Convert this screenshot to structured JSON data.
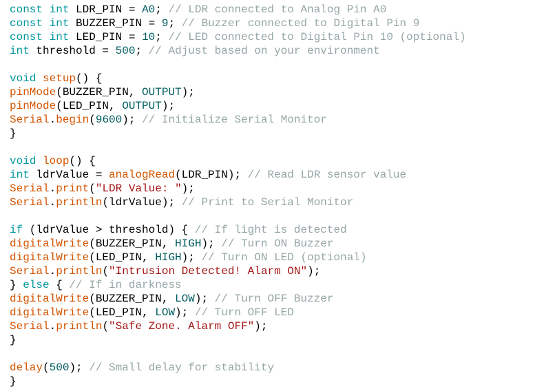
{
  "code": {
    "lines": [
      [
        {
          "t": "const",
          "k": "kw"
        },
        {
          "t": " ",
          "k": "id"
        },
        {
          "t": "int",
          "k": "kw"
        },
        {
          "t": " LDR_PIN = ",
          "k": "id"
        },
        {
          "t": "A0",
          "k": "num"
        },
        {
          "t": "; ",
          "k": "id"
        },
        {
          "t": "// LDR connected to Analog Pin A0",
          "k": "cm"
        }
      ],
      [
        {
          "t": "const",
          "k": "kw"
        },
        {
          "t": " ",
          "k": "id"
        },
        {
          "t": "int",
          "k": "kw"
        },
        {
          "t": " BUZZER_PIN = ",
          "k": "id"
        },
        {
          "t": "9",
          "k": "num"
        },
        {
          "t": "; ",
          "k": "id"
        },
        {
          "t": "// Buzzer connected to Digital Pin 9",
          "k": "cm"
        }
      ],
      [
        {
          "t": "const",
          "k": "kw"
        },
        {
          "t": " ",
          "k": "id"
        },
        {
          "t": "int",
          "k": "kw"
        },
        {
          "t": " LED_PIN = ",
          "k": "id"
        },
        {
          "t": "10",
          "k": "num"
        },
        {
          "t": "; ",
          "k": "id"
        },
        {
          "t": "// LED connected to Digital Pin 10 (optional)",
          "k": "cm"
        }
      ],
      [
        {
          "t": "int",
          "k": "kw"
        },
        {
          "t": " threshold = ",
          "k": "id"
        },
        {
          "t": "500",
          "k": "num"
        },
        {
          "t": "; ",
          "k": "id"
        },
        {
          "t": "// Adjust based on your environment",
          "k": "cm"
        }
      ],
      [],
      [
        {
          "t": "void",
          "k": "kw"
        },
        {
          "t": " ",
          "k": "id"
        },
        {
          "t": "setup",
          "k": "fn"
        },
        {
          "t": "() {",
          "k": "id"
        }
      ],
      [
        {
          "t": "pinMode",
          "k": "fn"
        },
        {
          "t": "(BUZZER_PIN, ",
          "k": "id"
        },
        {
          "t": "OUTPUT",
          "k": "num"
        },
        {
          "t": ");",
          "k": "id"
        }
      ],
      [
        {
          "t": "pinMode",
          "k": "fn"
        },
        {
          "t": "(LED_PIN, ",
          "k": "id"
        },
        {
          "t": "OUTPUT",
          "k": "num"
        },
        {
          "t": ");",
          "k": "id"
        }
      ],
      [
        {
          "t": "Serial",
          "k": "fn"
        },
        {
          "t": ".",
          "k": "id"
        },
        {
          "t": "begin",
          "k": "fn"
        },
        {
          "t": "(",
          "k": "id"
        },
        {
          "t": "9600",
          "k": "num"
        },
        {
          "t": "); ",
          "k": "id"
        },
        {
          "t": "// Initialize Serial Monitor",
          "k": "cm"
        }
      ],
      [
        {
          "t": "}",
          "k": "id"
        }
      ],
      [],
      [
        {
          "t": "void",
          "k": "kw"
        },
        {
          "t": " ",
          "k": "id"
        },
        {
          "t": "loop",
          "k": "fn"
        },
        {
          "t": "() {",
          "k": "id"
        }
      ],
      [
        {
          "t": "int",
          "k": "kw"
        },
        {
          "t": " ldrValue = ",
          "k": "id"
        },
        {
          "t": "analogRead",
          "k": "fn"
        },
        {
          "t": "(LDR_PIN); ",
          "k": "id"
        },
        {
          "t": "// Read LDR sensor value",
          "k": "cm"
        }
      ],
      [
        {
          "t": "Serial",
          "k": "fn"
        },
        {
          "t": ".",
          "k": "id"
        },
        {
          "t": "print",
          "k": "fn"
        },
        {
          "t": "(",
          "k": "id"
        },
        {
          "t": "\"LDR Value: \"",
          "k": "str"
        },
        {
          "t": ");",
          "k": "id"
        }
      ],
      [
        {
          "t": "Serial",
          "k": "fn"
        },
        {
          "t": ".",
          "k": "id"
        },
        {
          "t": "println",
          "k": "fn"
        },
        {
          "t": "(ldrValue); ",
          "k": "id"
        },
        {
          "t": "// Print to Serial Monitor",
          "k": "cm"
        }
      ],
      [],
      [
        {
          "t": "if",
          "k": "kw"
        },
        {
          "t": " (ldrValue > threshold) { ",
          "k": "id"
        },
        {
          "t": "// If light is detected",
          "k": "cm"
        }
      ],
      [
        {
          "t": "digitalWrite",
          "k": "fn"
        },
        {
          "t": "(BUZZER_PIN, ",
          "k": "id"
        },
        {
          "t": "HIGH",
          "k": "num"
        },
        {
          "t": "); ",
          "k": "id"
        },
        {
          "t": "// Turn ON Buzzer",
          "k": "cm"
        }
      ],
      [
        {
          "t": "digitalWrite",
          "k": "fn"
        },
        {
          "t": "(LED_PIN, ",
          "k": "id"
        },
        {
          "t": "HIGH",
          "k": "num"
        },
        {
          "t": "); ",
          "k": "id"
        },
        {
          "t": "// Turn ON LED (optional)",
          "k": "cm"
        }
      ],
      [
        {
          "t": "Serial",
          "k": "fn"
        },
        {
          "t": ".",
          "k": "id"
        },
        {
          "t": "println",
          "k": "fn"
        },
        {
          "t": "(",
          "k": "id"
        },
        {
          "t": "\"Intrusion Detected! Alarm ON\"",
          "k": "str"
        },
        {
          "t": ");",
          "k": "id"
        }
      ],
      [
        {
          "t": "} ",
          "k": "id"
        },
        {
          "t": "else",
          "k": "kw"
        },
        {
          "t": " { ",
          "k": "id"
        },
        {
          "t": "// If in darkness",
          "k": "cm"
        }
      ],
      [
        {
          "t": "digitalWrite",
          "k": "fn"
        },
        {
          "t": "(BUZZER_PIN, ",
          "k": "id"
        },
        {
          "t": "LOW",
          "k": "num"
        },
        {
          "t": "); ",
          "k": "id"
        },
        {
          "t": "// Turn OFF Buzzer",
          "k": "cm"
        }
      ],
      [
        {
          "t": "digitalWrite",
          "k": "fn"
        },
        {
          "t": "(LED_PIN, ",
          "k": "id"
        },
        {
          "t": "LOW",
          "k": "num"
        },
        {
          "t": "); ",
          "k": "id"
        },
        {
          "t": "// Turn OFF LED",
          "k": "cm"
        }
      ],
      [
        {
          "t": "Serial",
          "k": "fn"
        },
        {
          "t": ".",
          "k": "id"
        },
        {
          "t": "println",
          "k": "fn"
        },
        {
          "t": "(",
          "k": "id"
        },
        {
          "t": "\"Safe Zone. Alarm OFF\"",
          "k": "str"
        },
        {
          "t": ");",
          "k": "id"
        }
      ],
      [
        {
          "t": "}",
          "k": "id"
        }
      ],
      [],
      [
        {
          "t": "delay",
          "k": "fn"
        },
        {
          "t": "(",
          "k": "id"
        },
        {
          "t": "500",
          "k": "num"
        },
        {
          "t": "); ",
          "k": "id"
        },
        {
          "t": "// Small delay for stability",
          "k": "cm"
        }
      ],
      [
        {
          "t": "}",
          "k": "id"
        }
      ]
    ]
  },
  "colors": {
    "keyword": "#00979c",
    "function": "#d35400",
    "constant": "#005c5f",
    "string": "#a31515",
    "comment": "#95a5a6",
    "text": "#000000"
  }
}
